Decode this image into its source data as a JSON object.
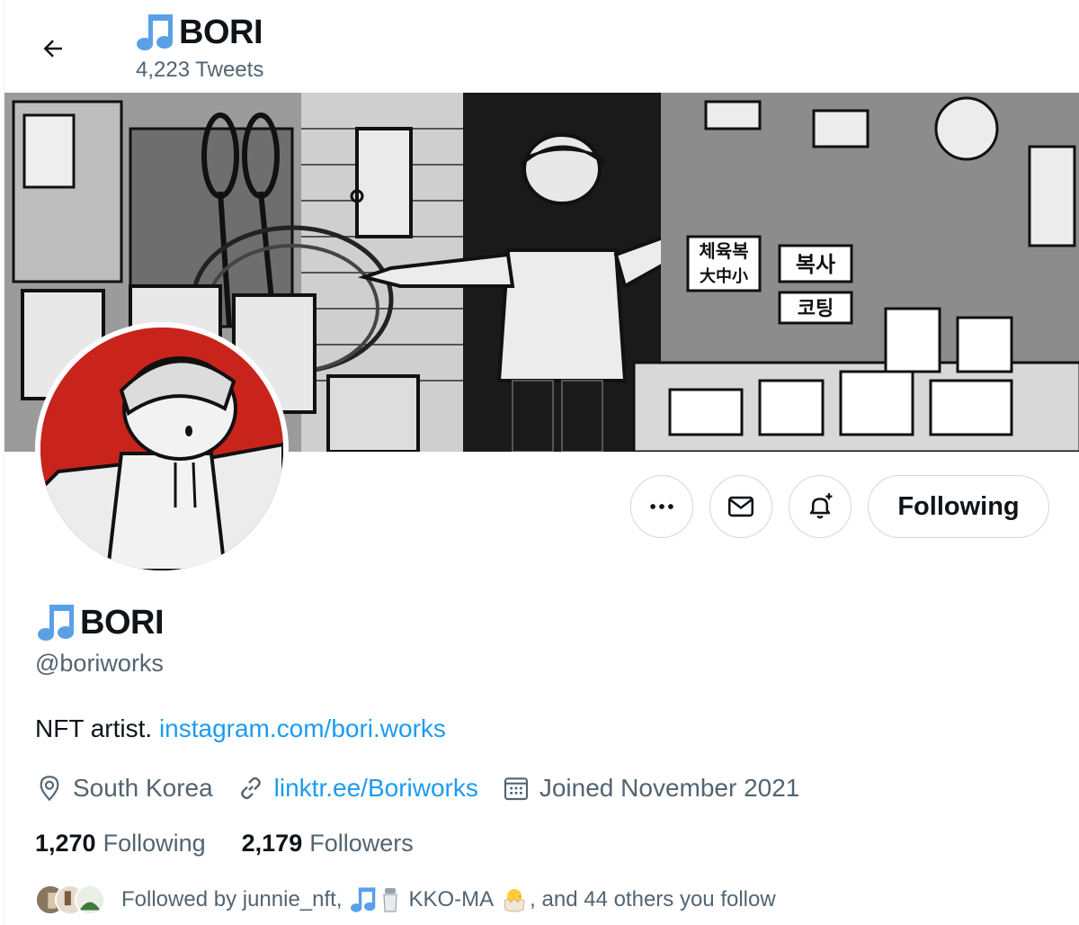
{
  "header": {
    "back_label": "back",
    "title": "BORI",
    "tweet_count": "4,223 Tweets"
  },
  "actions": {
    "more": "more-options",
    "message": "message",
    "notify": "notifications",
    "following_label": "Following"
  },
  "profile": {
    "display_name": "BORI",
    "handle": "@boriworks",
    "bio_text": "NFT artist.",
    "bio_link": "instagram.com/bori.works",
    "location": "South Korea",
    "website": "linktr.ee/Boriworks",
    "joined": "Joined November 2021",
    "following_count": "1,270",
    "following_label": "Following",
    "followers_count": "2,179",
    "followers_label": "Followers"
  },
  "banner_signs": {
    "sign1_line1": "체육복",
    "sign1_line2": "大中小",
    "sign2": "복사",
    "sign3": "코팅"
  },
  "followed_by": {
    "prefix": "Followed by junnie_nft,",
    "middle": "KKO-MA",
    "suffix": ", and 44 others you follow"
  },
  "colors": {
    "link": "#1d9bf0",
    "secondary_text": "#536471",
    "note_icon": "#5aa0e6",
    "avatar_bg": "#c8241c"
  },
  "icons": [
    "arrow-left-icon",
    "musical-note-icon",
    "more-icon",
    "mail-icon",
    "bell-plus-icon",
    "location-icon",
    "link-icon",
    "calendar-icon",
    "salt-shaker-icon",
    "hatching-chick-icon"
  ]
}
